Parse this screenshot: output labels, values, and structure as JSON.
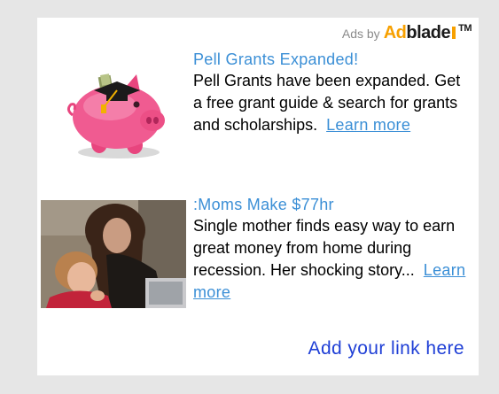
{
  "adsby": {
    "label": "Ads by",
    "brand_ad": "Ad",
    "brand_blade": "blade",
    "tm": "TM"
  },
  "ads": [
    {
      "title": "Pell Grants Expanded!",
      "description": "Pell Grants have been expanded. Get a free grant guide & search for grants and scholarships.",
      "learn_more": "Learn more"
    },
    {
      "title": ":Moms Make $77hr",
      "description": "Single mother finds easy way to earn great money from home during recession. Her shocking story...",
      "learn_more": "Learn more"
    }
  ],
  "add_link": "Add your link here",
  "colors": {
    "background": "#e6e6e6",
    "panel": "#ffffff",
    "link": "#3b8fd6",
    "add_link": "#1f3fd6",
    "brand_accent": "#f7a000"
  }
}
